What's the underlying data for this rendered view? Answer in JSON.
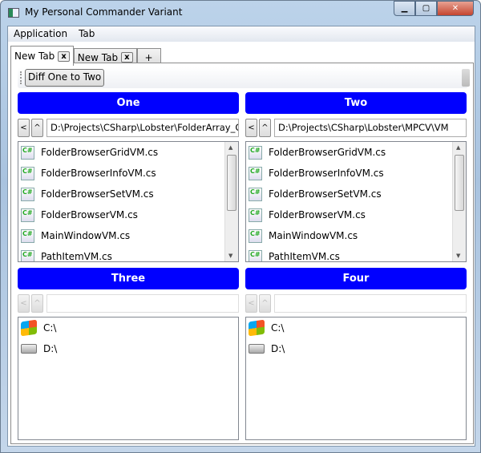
{
  "window": {
    "title": "My Personal Commander Variant"
  },
  "menu": [
    "Application",
    "Tab"
  ],
  "tabs": [
    {
      "label": "New Tab",
      "close": "x"
    },
    {
      "label": "New Tab",
      "close": "x"
    },
    {
      "label": "+"
    }
  ],
  "toolbar": {
    "diff_button": "Diff One to Two"
  },
  "panels": [
    {
      "header": "One",
      "back": "<",
      "up": "^",
      "path": "D:\\Projects\\CSharp\\Lobster\\FolderArray_Old\\VM",
      "items": [
        "FolderBrowserGridVM.cs",
        "FolderBrowserInfoVM.cs",
        "FolderBrowserSetVM.cs",
        "FolderBrowserVM.cs",
        "MainWindowVM.cs",
        "PathItemVM.cs"
      ]
    },
    {
      "header": "Two",
      "back": "<",
      "up": "^",
      "path": "D:\\Projects\\CSharp\\Lobster\\MPCV\\VM",
      "items": [
        "FolderBrowserGridVM.cs",
        "FolderBrowserInfoVM.cs",
        "FolderBrowserSetVM.cs",
        "FolderBrowserVM.cs",
        "MainWindowVM.cs",
        "PathItemVM.cs"
      ]
    },
    {
      "header": "Three",
      "back": "<",
      "up": "^",
      "path": "",
      "items": [
        "C:\\",
        "D:\\"
      ]
    },
    {
      "header": "Four",
      "back": "<",
      "up": "^",
      "path": "",
      "items": [
        "C:\\",
        "D:\\"
      ]
    }
  ],
  "colors": {
    "header": "#0000ff"
  }
}
